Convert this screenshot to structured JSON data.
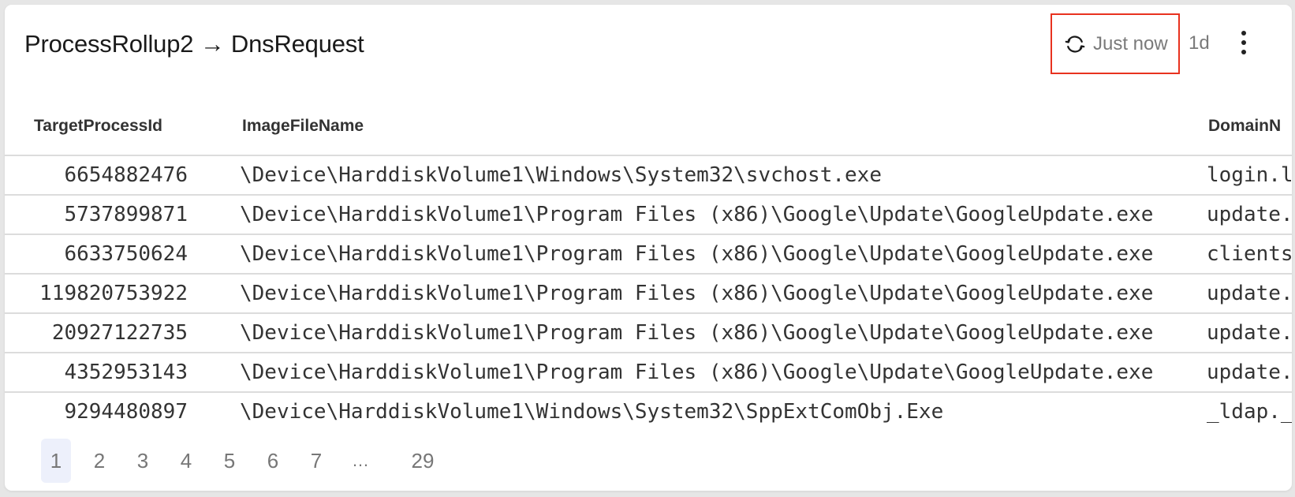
{
  "panel": {
    "title": "ProcessRollup2 → DnsRequest",
    "refresh": {
      "icon": "refresh-icon",
      "label": "Just now",
      "highlight_color": "#e8321f"
    },
    "time_range": "1d",
    "menu_icon": "kebab-menu-icon"
  },
  "table": {
    "columns": [
      "TargetProcessId",
      "ImageFileName",
      "DomainN"
    ],
    "rows": [
      {
        "TargetProcessId": "6654882476",
        "ImageFileName": "\\Device\\HarddiskVolume1\\Windows\\System32\\svchost.exe",
        "DomainName": "login.l"
      },
      {
        "TargetProcessId": "5737899871",
        "ImageFileName": "\\Device\\HarddiskVolume1\\Program Files (x86)\\Google\\Update\\GoogleUpdate.exe",
        "DomainName": "update."
      },
      {
        "TargetProcessId": "6633750624",
        "ImageFileName": "\\Device\\HarddiskVolume1\\Program Files (x86)\\Google\\Update\\GoogleUpdate.exe",
        "DomainName": "clients"
      },
      {
        "TargetProcessId": "119820753922",
        "ImageFileName": "\\Device\\HarddiskVolume1\\Program Files (x86)\\Google\\Update\\GoogleUpdate.exe",
        "DomainName": "update."
      },
      {
        "TargetProcessId": "20927122735",
        "ImageFileName": "\\Device\\HarddiskVolume1\\Program Files (x86)\\Google\\Update\\GoogleUpdate.exe",
        "DomainName": "update."
      },
      {
        "TargetProcessId": "4352953143",
        "ImageFileName": "\\Device\\HarddiskVolume1\\Program Files (x86)\\Google\\Update\\GoogleUpdate.exe",
        "DomainName": "update."
      },
      {
        "TargetProcessId": "9294480897",
        "ImageFileName": "\\Device\\HarddiskVolume1\\Windows\\System32\\SppExtComObj.Exe",
        "DomainName": "_ldap._"
      }
    ]
  },
  "pagination": {
    "pages": [
      "1",
      "2",
      "3",
      "4",
      "5",
      "6",
      "7"
    ],
    "ellipsis": "…",
    "last": "29",
    "current": "1",
    "active_bg": "#edf0fb"
  }
}
